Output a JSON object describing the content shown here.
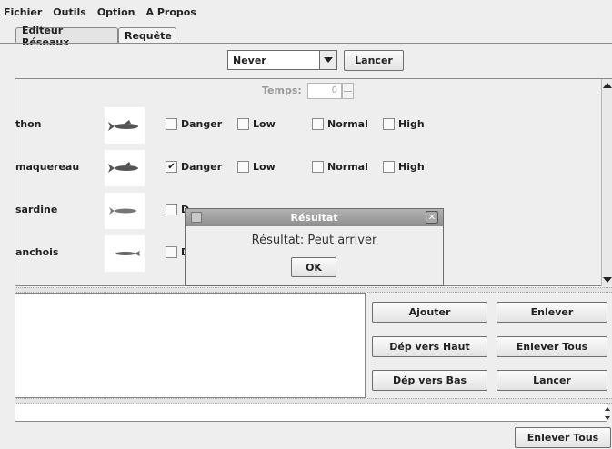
{
  "menu": {
    "fichier": "Fichier",
    "outils": "Outils",
    "option": "Option",
    "apropos": "A Propos"
  },
  "tabs": [
    {
      "label": "Editeur Réseaux",
      "active": false
    },
    {
      "label": "Requête",
      "active": true
    }
  ],
  "toolbar": {
    "combo_value": "Never",
    "run_label": "Lancer"
  },
  "query": {
    "temps_label": "Temps:",
    "temps_value": "0",
    "check_labels": [
      "Danger",
      "Low",
      "Normal",
      "High"
    ],
    "rows": [
      {
        "name": "thon",
        "checked": [
          false,
          false,
          false,
          false
        ]
      },
      {
        "name": "maquereau",
        "checked": [
          true,
          false,
          false,
          false
        ]
      },
      {
        "name": "sardine",
        "checked": [
          false,
          false,
          false,
          false
        ]
      },
      {
        "name": "anchois",
        "checked": [
          false,
          false,
          false,
          false
        ]
      }
    ]
  },
  "dialog": {
    "title": "Résultat",
    "message": "Résultat: Peut arriver",
    "ok": "OK"
  },
  "actions": {
    "ajouter": "Ajouter",
    "enlever": "Enlever",
    "dep_haut": "Dép vers Haut",
    "enlever_tous": "Enlever Tous",
    "dep_bas": "Dép vers Bas",
    "lancer": "Lancer"
  },
  "bottom": {
    "enlever_tous": "Enlever Tous"
  }
}
